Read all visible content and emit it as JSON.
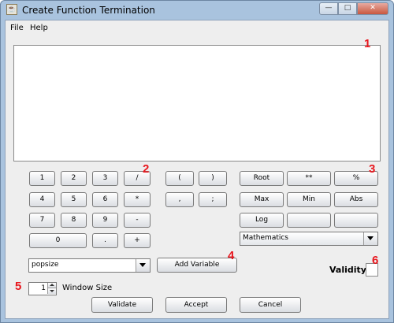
{
  "window": {
    "title": "Create Function Termination",
    "app_icon_glyph": "☕",
    "minimize_glyph": "—",
    "maximize_glyph": "□",
    "close_glyph": "✕"
  },
  "menu": {
    "file": "File",
    "help": "Help"
  },
  "expression_area": {
    "value": ""
  },
  "keypad": {
    "row1": [
      "1",
      "2",
      "3",
      "/"
    ],
    "row2": [
      "4",
      "5",
      "6",
      "*"
    ],
    "row3": [
      "7",
      "8",
      "9",
      "-"
    ],
    "row4": [
      "0",
      ".",
      "+"
    ]
  },
  "symbols": {
    "open_paren": "(",
    "close_paren": ")",
    "comma": ",",
    "semicolon": ";"
  },
  "functions": {
    "row1": [
      "Root",
      "**",
      "%"
    ],
    "row2": [
      "Max",
      "Min",
      "Abs"
    ],
    "row3": [
      "Log",
      "",
      ""
    ],
    "category_selected": "Mathematics"
  },
  "variable": {
    "selected": "popsize",
    "add_label": "Add Variable"
  },
  "window_size": {
    "value": "1",
    "label": "Window Size"
  },
  "validity": {
    "label": "Validity"
  },
  "actions": {
    "validate": "Validate",
    "accept": "Accept",
    "cancel": "Cancel"
  },
  "markers": [
    "1",
    "2",
    "3",
    "4",
    "5",
    "6"
  ],
  "colors": {
    "marker": "#e8161d",
    "title_bar": "#a9c3de",
    "close_button": "#c9573f",
    "panel": "#eeeeee"
  },
  "icons": [
    "java-app-icon",
    "minimize-icon",
    "maximize-icon",
    "close-icon",
    "chevron-down-icon",
    "spinner-up-icon",
    "spinner-down-icon"
  ]
}
